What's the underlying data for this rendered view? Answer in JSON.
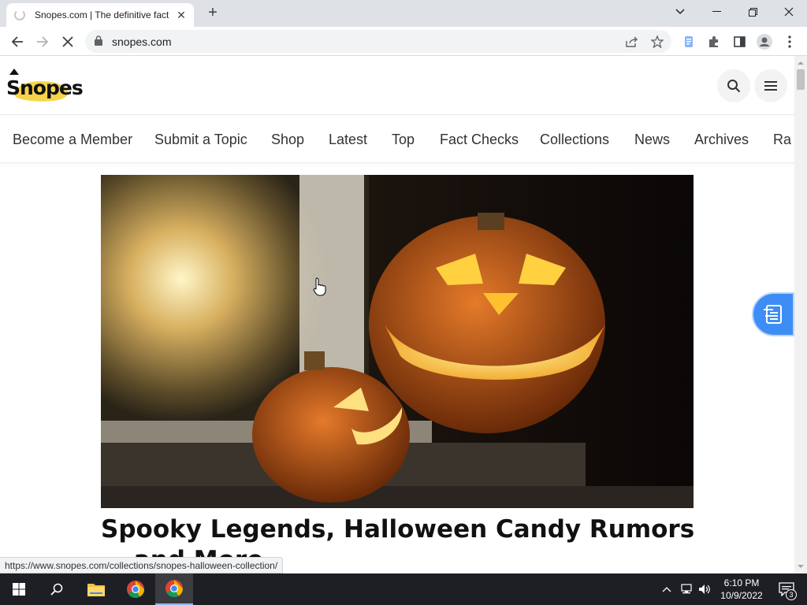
{
  "browser": {
    "tab_title": "Snopes.com | The definitive fact-checking site",
    "tab_close": "✕",
    "new_tab": "+",
    "url": "snopes.com"
  },
  "site": {
    "logo_text": "Snopes",
    "nav": [
      "Become a Member",
      "Submit a Topic",
      "Shop",
      "Latest",
      "Top",
      "Fact Checks",
      "Collections",
      "News",
      "Archives",
      "Ra"
    ]
  },
  "article": {
    "headline": "Spooky Legends, Halloween Candy Rumors — and More"
  },
  "status_bar": {
    "link_url": "https://www.snopes.com/collections/snopes-halloween-collection/"
  },
  "taskbar": {
    "time": "6:10 PM",
    "date": "10/9/2022",
    "notification_count": "3"
  },
  "colors": {
    "accent_blue": "#3d8df5",
    "logo_yellow": "#f6d44a",
    "taskbar_bg": "#1e1f25"
  }
}
